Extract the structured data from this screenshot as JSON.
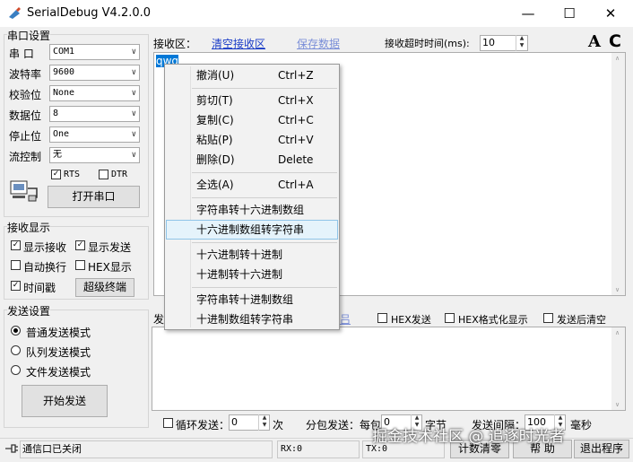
{
  "app": {
    "title": "SerialDebug V4.2.0.0",
    "minimize": "—",
    "maximize": "☐",
    "close": "✕"
  },
  "port_settings": {
    "group_title": "串口设置",
    "fields": [
      {
        "label": "串 口",
        "value": "COM1"
      },
      {
        "label": "波特率",
        "value": "9600"
      },
      {
        "label": "校验位",
        "value": "None"
      },
      {
        "label": "数据位",
        "value": "8"
      },
      {
        "label": "停止位",
        "value": "One"
      },
      {
        "label": "流控制",
        "value": "无"
      }
    ],
    "rts_label": "RTS",
    "rts_checked": true,
    "dtr_label": "DTR",
    "dtr_checked": false,
    "open_button": "打开串口"
  },
  "receive_display": {
    "group_title": "接收显示",
    "show_receive": "显示接收",
    "show_send": "显示发送",
    "auto_wrap": "自动换行",
    "hex_display": "HEX显示",
    "timestamp": "时间戳",
    "super_terminal": "超级终端"
  },
  "send_settings": {
    "group_title": "发送设置",
    "mode_normal": "普通发送模式",
    "mode_queue": "队列发送模式",
    "mode_file": "文件发送模式",
    "start_button": "开始发送"
  },
  "receive_area": {
    "label": "接收区：",
    "clear_link": "清空接收区",
    "save_link": "保存数据",
    "timeout_label": "接收超时时间(ms):",
    "timeout_value": "10",
    "content": "qwq"
  },
  "send_area": {
    "label_partial": "发",
    "hex_send": "HEX发送",
    "hex_format": "HEX格式化显示",
    "clear_after_send": "发送后清空",
    "partial_text": "吕"
  },
  "bottom_bar": {
    "loop_send": "循环发送：",
    "loop_value": "0",
    "loop_unit": "次",
    "packet_send": "分包发送：每包",
    "packet_value": "0",
    "packet_unit": "字节",
    "interval_label": "发送间隔：",
    "interval_value": "100",
    "interval_unit": "毫秒"
  },
  "status_bar": {
    "port_status": "通信口已关闭",
    "rx": "RX:0",
    "tx": "TX:0",
    "counter_clear": "计数清零",
    "help": "帮 助",
    "exit": "退出程序"
  },
  "context_menu": {
    "items": [
      {
        "label": "撤消(U)",
        "shortcut": "Ctrl+Z"
      },
      {
        "label": "剪切(T)",
        "shortcut": "Ctrl+X"
      },
      {
        "label": "复制(C)",
        "shortcut": "Ctrl+C"
      },
      {
        "label": "粘贴(P)",
        "shortcut": "Ctrl+V"
      },
      {
        "label": "删除(D)",
        "shortcut": "Delete"
      },
      {
        "label": "全选(A)",
        "shortcut": "Ctrl+A"
      },
      {
        "label": "字符串转十六进制数组",
        "shortcut": ""
      },
      {
        "label": "十六进制数组转字符串",
        "shortcut": ""
      },
      {
        "label": "十六进制转十进制",
        "shortcut": ""
      },
      {
        "label": "十进制转十六进制",
        "shortcut": ""
      },
      {
        "label": "字符串转十进制数组",
        "shortcut": ""
      },
      {
        "label": "十进制数组转字符串",
        "shortcut": ""
      }
    ]
  },
  "watermark": "掘金技术社区 @ 追逐时光者",
  "font_tool": "A",
  "refresh_tool": "C"
}
